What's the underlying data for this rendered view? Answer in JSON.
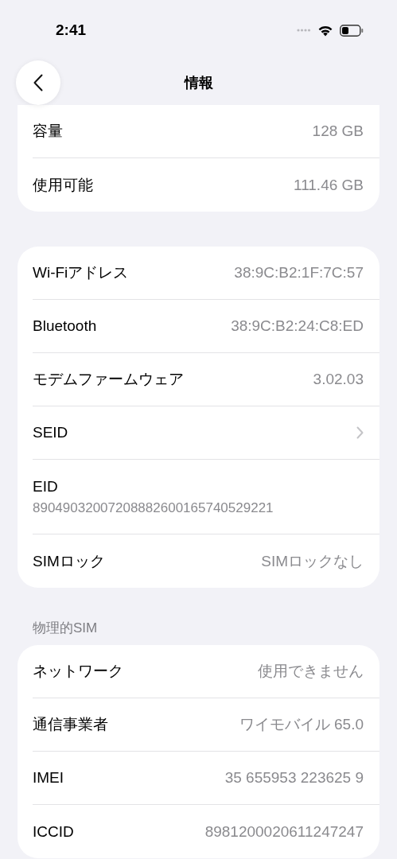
{
  "status_bar": {
    "time": "2:41"
  },
  "nav": {
    "title": "情報"
  },
  "groups": [
    {
      "rows": [
        {
          "kind": "value",
          "label": "容量",
          "value": "128 GB"
        },
        {
          "kind": "value",
          "label": "使用可能",
          "value": "111.46 GB"
        }
      ]
    },
    {
      "rows": [
        {
          "kind": "value",
          "label": "Wi-Fiアドレス",
          "value": "38:9C:B2:1F:7C:57"
        },
        {
          "kind": "value",
          "label": "Bluetooth",
          "value": "38:9C:B2:24:C8:ED"
        },
        {
          "kind": "value",
          "label": "モデムファームウェア",
          "value": "3.02.03"
        },
        {
          "kind": "chevron",
          "label": "SEID"
        },
        {
          "kind": "stacked",
          "label": "EID",
          "value": "89049032007208882600165740529221"
        },
        {
          "kind": "value",
          "label": "SIMロック",
          "value": "SIMロックなし"
        }
      ]
    },
    {
      "header": "物理的SIM",
      "rows": [
        {
          "kind": "value",
          "label": "ネットワーク",
          "value": "使用できません"
        },
        {
          "kind": "value",
          "label": "通信事業者",
          "value": "ワイモバイル 65.0"
        },
        {
          "kind": "value",
          "label": "IMEI",
          "value": "35 655953 223625 9"
        },
        {
          "kind": "value",
          "label": "ICCID",
          "value": "8981200020611247247"
        }
      ]
    }
  ]
}
